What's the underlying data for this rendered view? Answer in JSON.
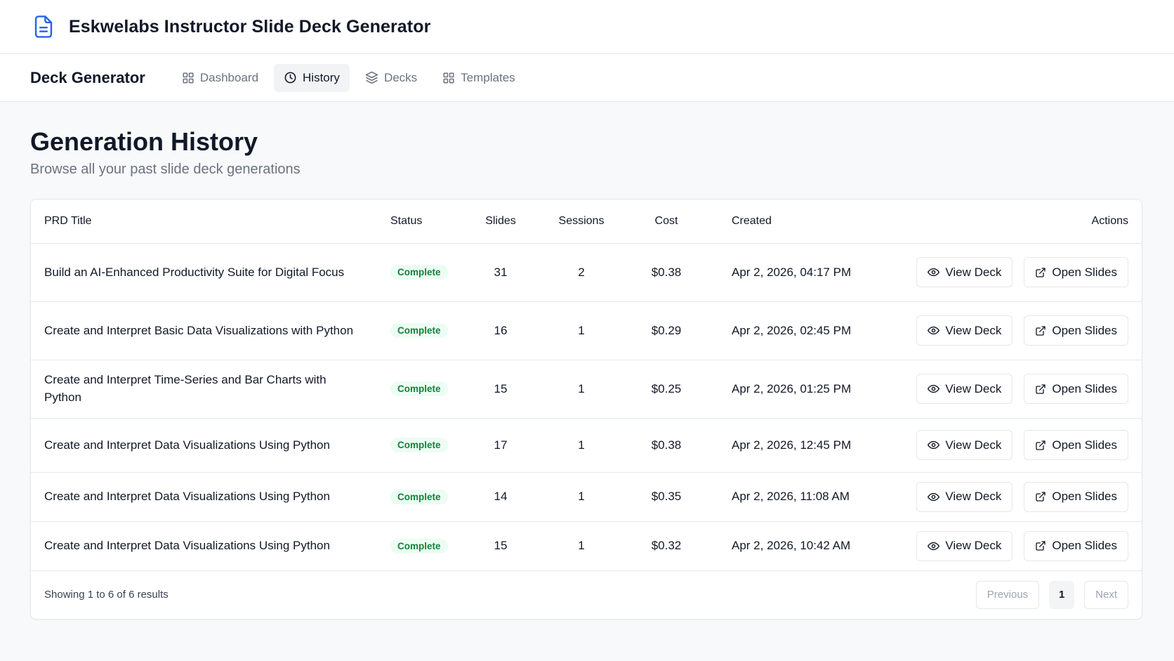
{
  "app": {
    "title": "Eskwelabs Instructor Slide Deck Generator"
  },
  "nav": {
    "brand": "Deck Generator",
    "items": [
      {
        "label": "Dashboard",
        "icon": "grid-icon",
        "active": false
      },
      {
        "label": "History",
        "icon": "clock-icon",
        "active": true
      },
      {
        "label": "Decks",
        "icon": "layers-icon",
        "active": false
      },
      {
        "label": "Templates",
        "icon": "grid-icon",
        "active": false
      }
    ]
  },
  "page": {
    "title": "Generation History",
    "subtitle": "Browse all your past slide deck generations"
  },
  "table": {
    "headers": {
      "title": "PRD Title",
      "status": "Status",
      "slides": "Slides",
      "sessions": "Sessions",
      "cost": "Cost",
      "created": "Created",
      "actions": "Actions"
    },
    "view_label": "View Deck",
    "open_label": "Open Slides",
    "rows": [
      {
        "title": "Build an AI-Enhanced Productivity Suite for Digital Focus",
        "status": "Complete",
        "slides": "31",
        "sessions": "2",
        "cost": "$0.38",
        "created": "Apr 2, 2026, 04:17 PM"
      },
      {
        "title": "Create and Interpret Basic Data Visualizations with Python",
        "status": "Complete",
        "slides": "16",
        "sessions": "1",
        "cost": "$0.29",
        "created": "Apr 2, 2026, 02:45 PM"
      },
      {
        "title": "Create and Interpret Time-Series and Bar Charts with Python",
        "status": "Complete",
        "slides": "15",
        "sessions": "1",
        "cost": "$0.25",
        "created": "Apr 2, 2026, 01:25 PM"
      },
      {
        "title": "Create and Interpret Data Visualizations Using Python",
        "status": "Complete",
        "slides": "17",
        "sessions": "1",
        "cost": "$0.38",
        "created": "Apr 2, 2026, 12:45 PM"
      },
      {
        "title": "Create and Interpret Data Visualizations Using Python",
        "status": "Complete",
        "slides": "14",
        "sessions": "1",
        "cost": "$0.35",
        "created": "Apr 2, 2026, 11:08 AM"
      },
      {
        "title": "Create and Interpret Data Visualizations Using Python",
        "status": "Complete",
        "slides": "15",
        "sessions": "1",
        "cost": "$0.32",
        "created": "Apr 2, 2026, 10:42 AM"
      }
    ]
  },
  "pagination": {
    "summary": "Showing 1 to 6 of 6 results",
    "previous": "Previous",
    "current_page": "1",
    "next": "Next"
  },
  "colors": {
    "accent": "#2563eb",
    "badge_bg": "#ecfdf3",
    "badge_text": "#15803d",
    "border": "#e5e7eb"
  }
}
